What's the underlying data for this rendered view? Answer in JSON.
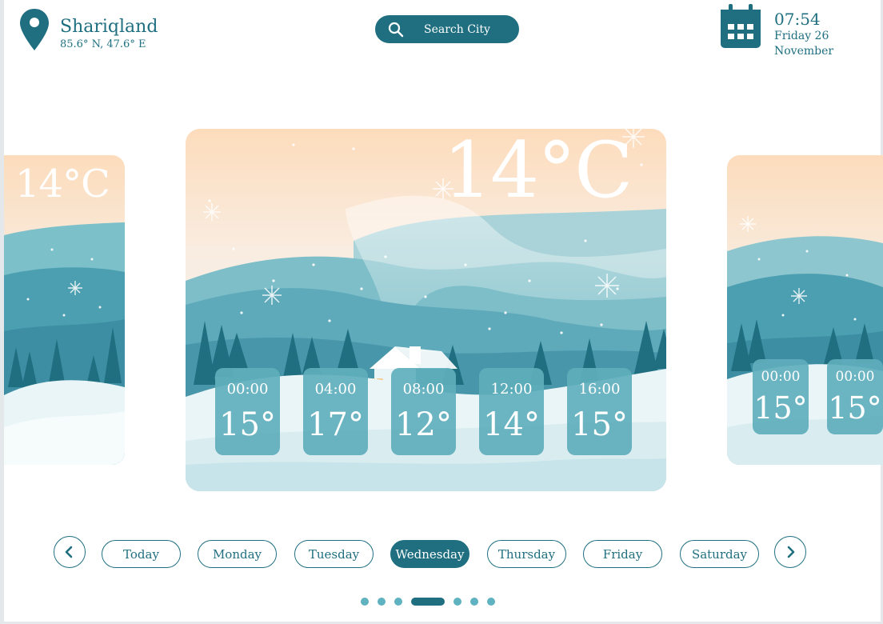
{
  "location": {
    "icon": "map-pin-icon",
    "city": "Shariqland",
    "coords": "85.6° N, 47.6° E"
  },
  "search": {
    "icon": "search-icon",
    "placeholder": "Search City"
  },
  "datetime": {
    "icon": "calendar-icon",
    "time": "07:54",
    "date_line1": "Friday 26",
    "date_line2": "November"
  },
  "cards": {
    "left": {
      "temperature": "14°C"
    },
    "main": {
      "temperature": "14°C",
      "hours": [
        {
          "time": "00:00",
          "temp": "15°"
        },
        {
          "time": "04:00",
          "temp": "17°"
        },
        {
          "time": "08:00",
          "temp": "12°"
        },
        {
          "time": "12:00",
          "temp": "14°"
        },
        {
          "time": "16:00",
          "temp": "15°"
        }
      ]
    },
    "right": {
      "hours": [
        {
          "time": "00:00",
          "temp": "15°"
        },
        {
          "time": "00:00",
          "temp": "15°"
        }
      ]
    }
  },
  "days": {
    "prev_icon": "chevron-left-icon",
    "next_icon": "chevron-right-icon",
    "items": [
      {
        "label": "Today"
      },
      {
        "label": "Monday"
      },
      {
        "label": "Tuesday"
      },
      {
        "label": "Wednesday",
        "active": true
      },
      {
        "label": "Thursday"
      },
      {
        "label": "Friday"
      },
      {
        "label": "Saturday"
      }
    ]
  },
  "pagination": {
    "count": 7,
    "active_index": 3
  },
  "colors": {
    "primary": "#1f6f80",
    "accent": "#5fb2c0",
    "sky_top": "#fde0c0",
    "snow": "#eaf5f8"
  }
}
